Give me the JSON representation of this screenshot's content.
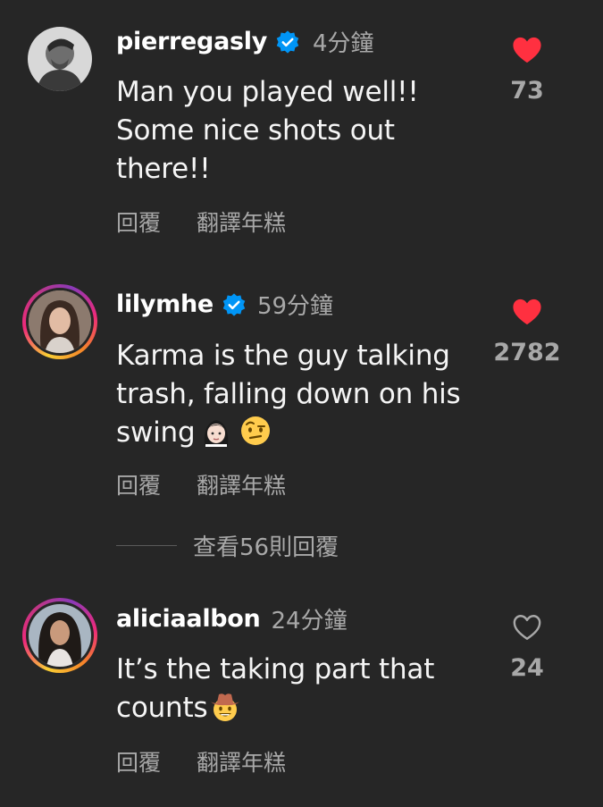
{
  "comments": [
    {
      "username": "pierregasly",
      "verified": true,
      "time": "4分鐘",
      "text": "Man you played well!! Some nice shots out there!!",
      "liked": true,
      "likes": "73",
      "reply_label": "回覆",
      "translate_label": "翻譯年糕",
      "avatar_ring": false
    },
    {
      "username": "lilymhe",
      "verified": true,
      "time": "59分鐘",
      "text": "Karma is the guy talking trash, falling down on his swing",
      "text_emojis": [
        "woman-face-emoji",
        "face-with-raised-eyebrow-emoji"
      ],
      "liked": true,
      "likes": "2782",
      "reply_label": "回覆",
      "translate_label": "翻譯年糕",
      "avatar_ring": true,
      "view_replies": "查看56則回覆"
    },
    {
      "username": "aliciaalbon",
      "verified": false,
      "time": "24分鐘",
      "text": "It’s the taking part that counts",
      "text_emojis": [
        "cowboy-hat-face-emoji"
      ],
      "liked": false,
      "likes": "24",
      "reply_label": "回覆",
      "translate_label": "翻譯年糕",
      "avatar_ring": true
    }
  ],
  "colors": {
    "background": "#262626",
    "text_primary": "#ffffff",
    "text_secondary": "#a8a8a8",
    "like_red": "#ff3040",
    "verified_blue": "#0095f6"
  }
}
